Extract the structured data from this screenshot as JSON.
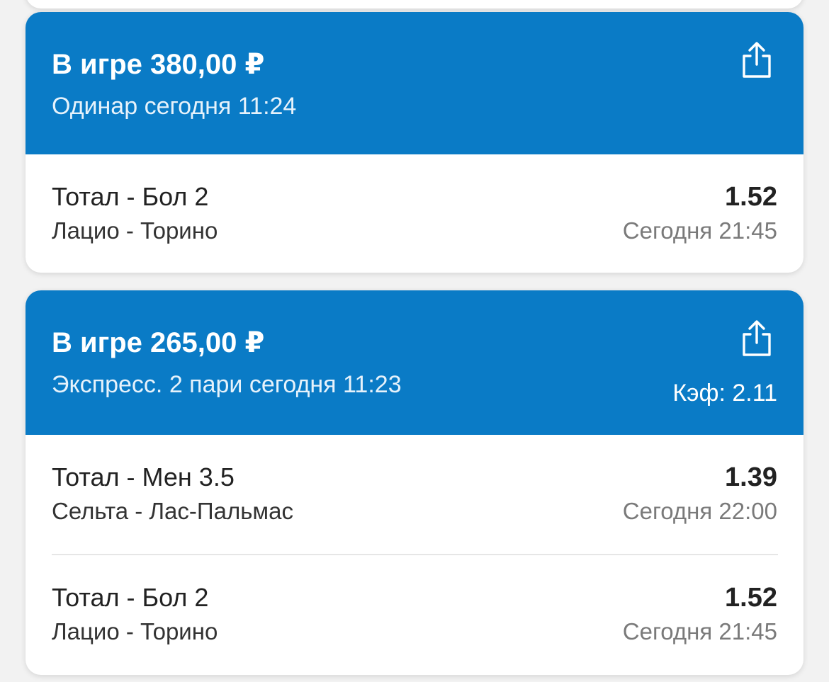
{
  "bets": [
    {
      "header": {
        "title": "В игре 380,00 ₽",
        "subtitle": "Одинар сегодня 11:24",
        "coef": ""
      },
      "selections": [
        {
          "market": "Тотал - Бол 2",
          "event": "Лацио - Торино",
          "odds": "1.52",
          "time": "Сегодня 21:45"
        }
      ]
    },
    {
      "header": {
        "title": "В игре 265,00 ₽",
        "subtitle": "Экспресс. 2 пари сегодня 11:23",
        "coef": "Кэф: 2.11"
      },
      "selections": [
        {
          "market": "Тотал - Мен 3.5",
          "event": "Сельта - Лас-Пальмас",
          "odds": "1.39",
          "time": "Сегодня 22:00"
        },
        {
          "market": "Тотал - Бол 2",
          "event": "Лацио - Торино",
          "odds": "1.52",
          "time": "Сегодня 21:45"
        }
      ]
    }
  ],
  "icons": {
    "share": "share-icon"
  },
  "colors": {
    "header_bg": "#0a7bc6",
    "page_bg": "#f2f2f2",
    "card_bg": "#ffffff",
    "muted_text": "#7a7a7a"
  }
}
